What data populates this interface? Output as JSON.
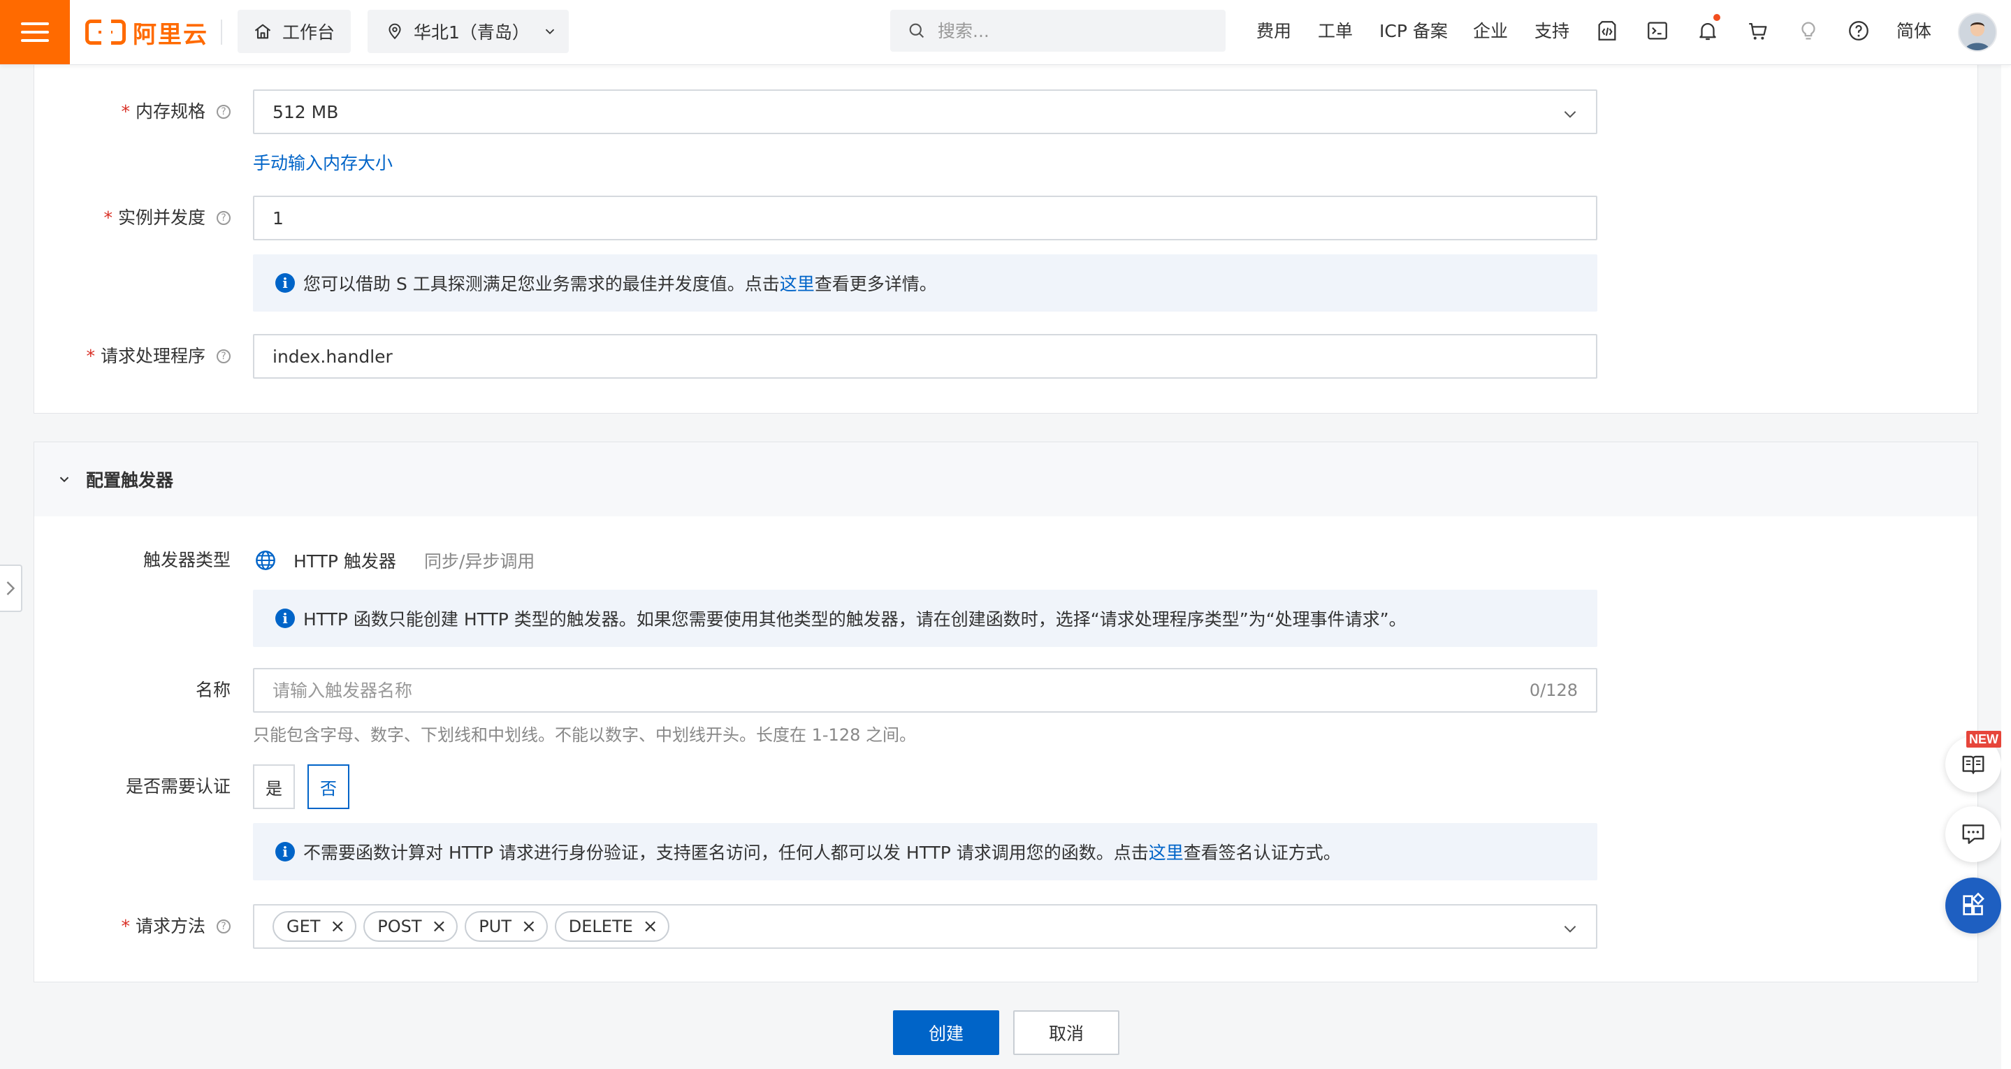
{
  "topbar": {
    "logo_text": "阿里云",
    "workbench_label": "工作台",
    "region_label": "华北1（青岛）",
    "search_placeholder": "搜索...",
    "links": [
      "费用",
      "工单",
      "ICP 备案",
      "企业",
      "支持"
    ],
    "lang_label": "简体",
    "icons": [
      "menu-icon",
      "home-icon",
      "location-pin-icon",
      "chevron-down-icon",
      "search-icon",
      "code-icon",
      "terminal-icon",
      "bell-icon",
      "cart-icon",
      "bulb-icon",
      "help-icon"
    ]
  },
  "function_config": {
    "memory": {
      "label": "内存规格",
      "value": "512 MB",
      "manual_link": "手动输入内存大小"
    },
    "concurrency": {
      "label": "实例并发度",
      "value": "1",
      "note_pre": "您可以借助 S 工具探测满足您业务需求的最佳并发度值。点击",
      "note_link": "这里",
      "note_post": "查看更多详情。"
    },
    "handler": {
      "label": "请求处理程序",
      "value": "index.handler"
    }
  },
  "trigger": {
    "section_title": "配置触发器",
    "type": {
      "label": "触发器类型",
      "value": "HTTP 触发器",
      "sub": "同步/异步调用"
    },
    "type_note": "HTTP 函数只能创建 HTTP 类型的触发器。如果您需要使用其他类型的触发器，请在创建函数时，选择“请求处理程序类型”为“处理事件请求”。",
    "name": {
      "label": "名称",
      "placeholder": "请输入触发器名称",
      "counter": "0/128",
      "hint": "只能包含字母、数字、下划线和中划线。不能以数字、中划线开头。长度在 1-128 之间。"
    },
    "auth": {
      "label": "是否需要认证",
      "yes": "是",
      "no": "否",
      "selected": "否",
      "note_pre": "不需要函数计算对 HTTP 请求进行身份验证，支持匿名访问，任何人都可以发 HTTP 请求调用您的函数。点击",
      "note_link": "这里",
      "note_post": "查看签名认证方式。"
    },
    "methods": {
      "label": "请求方法",
      "tags": [
        "GET",
        "POST",
        "PUT",
        "DELETE"
      ]
    }
  },
  "actions": {
    "create": "创建",
    "cancel": "取消"
  },
  "float": {
    "new_badge": "NEW"
  },
  "colors": {
    "brand": "#ff6a00",
    "primary": "#0064c8",
    "required": "#d93026",
    "note_bg": "#f0f4fa"
  }
}
